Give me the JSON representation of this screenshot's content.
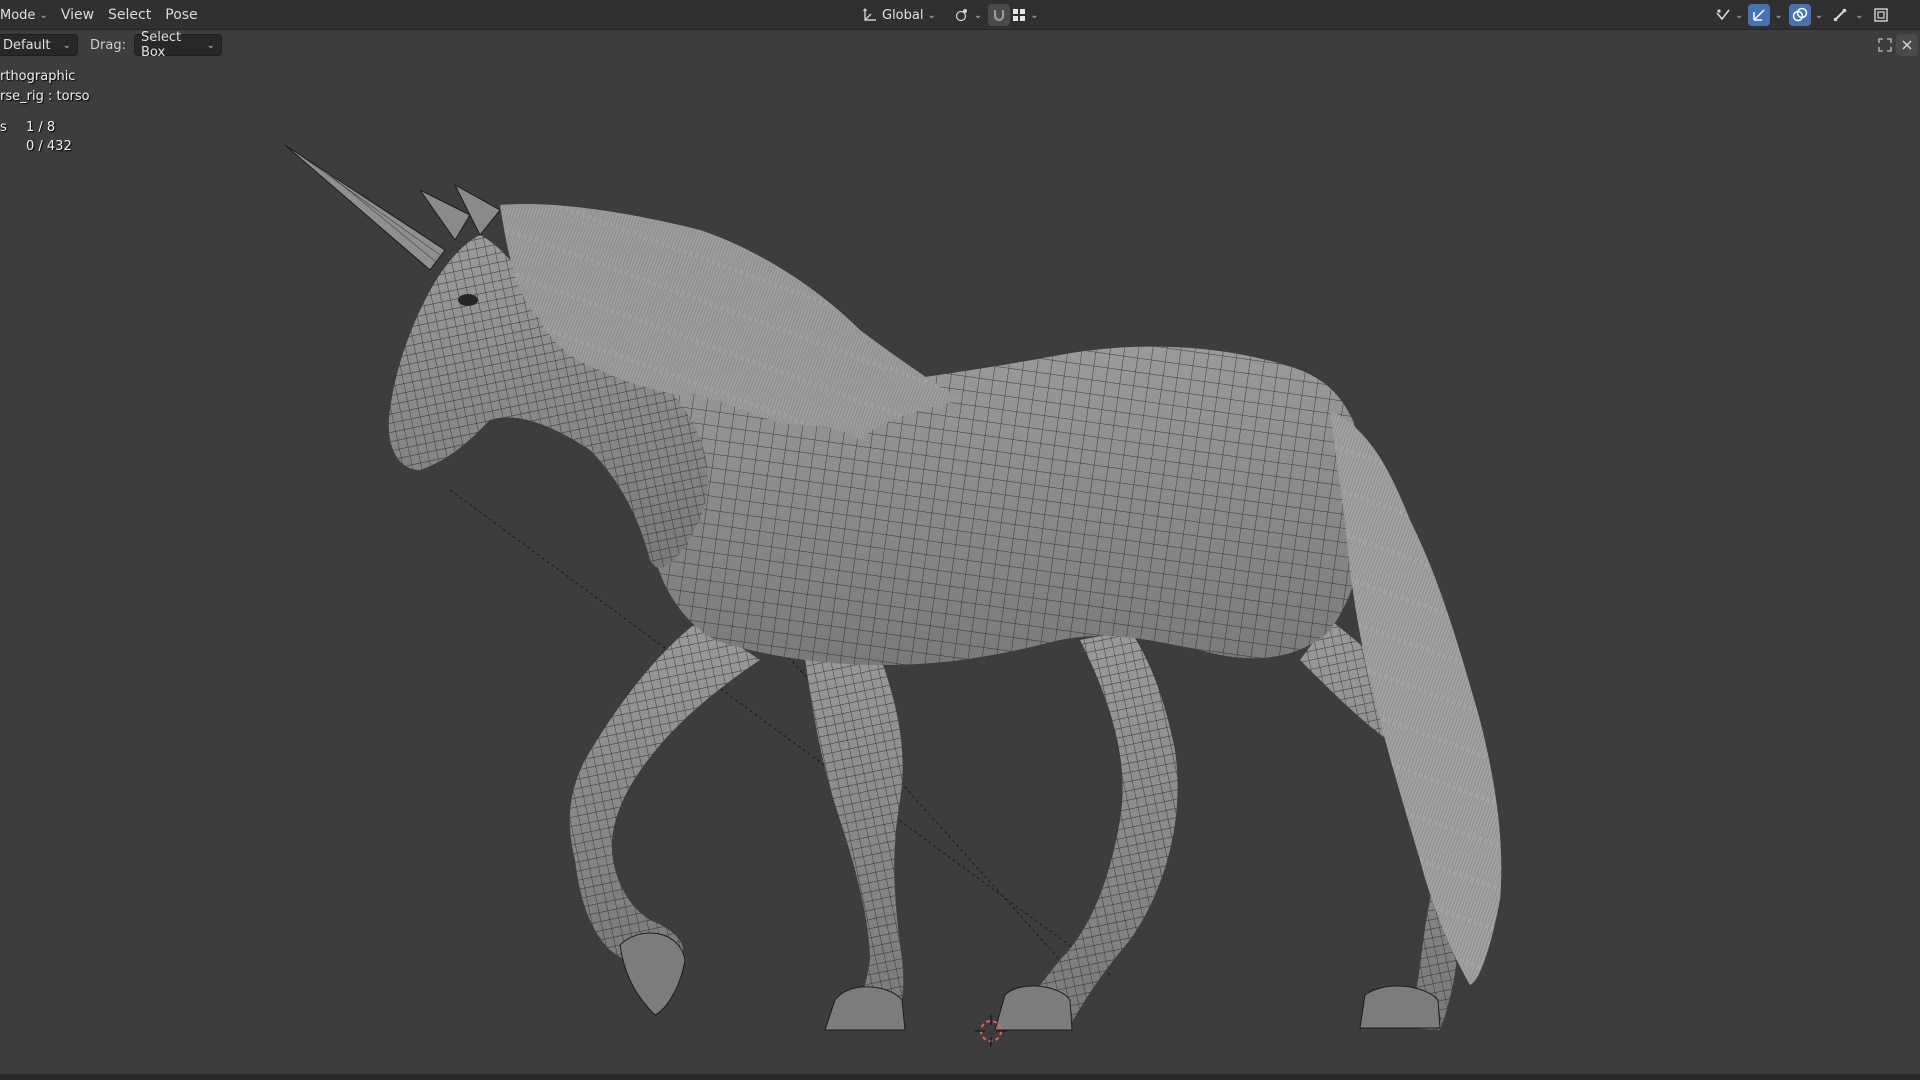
{
  "header": {
    "mode_label": "Mode",
    "menu": {
      "view": "View",
      "select": "Select",
      "pose": "Pose"
    },
    "transform_orientation": "Global"
  },
  "toolbar": {
    "keymap_value": "Default",
    "drag_label": "Drag:",
    "drag_value": "Select Box"
  },
  "viewport": {
    "view_name": "rthographic",
    "active_bone": "rse_rig : torso",
    "stats": [
      {
        "label": "s",
        "value": "1 / 8"
      },
      {
        "label": "",
        "value": "0 / 432"
      }
    ]
  },
  "colors": {
    "header_bg": "#303030",
    "viewport_bg": "#3d3d3d",
    "accent": "#4772b3",
    "mesh_fill": "#8c8c8c",
    "wire": "#1c1c1c",
    "cursor_red": "#e06060"
  },
  "icons": {
    "transform_orientation": "axes-icon",
    "snap": "magnet-icon",
    "proportional": "proportional-edit-icon",
    "gizmo": "gizmo-icon",
    "overlays": "overlays-icon",
    "xray": "xray-icon"
  }
}
